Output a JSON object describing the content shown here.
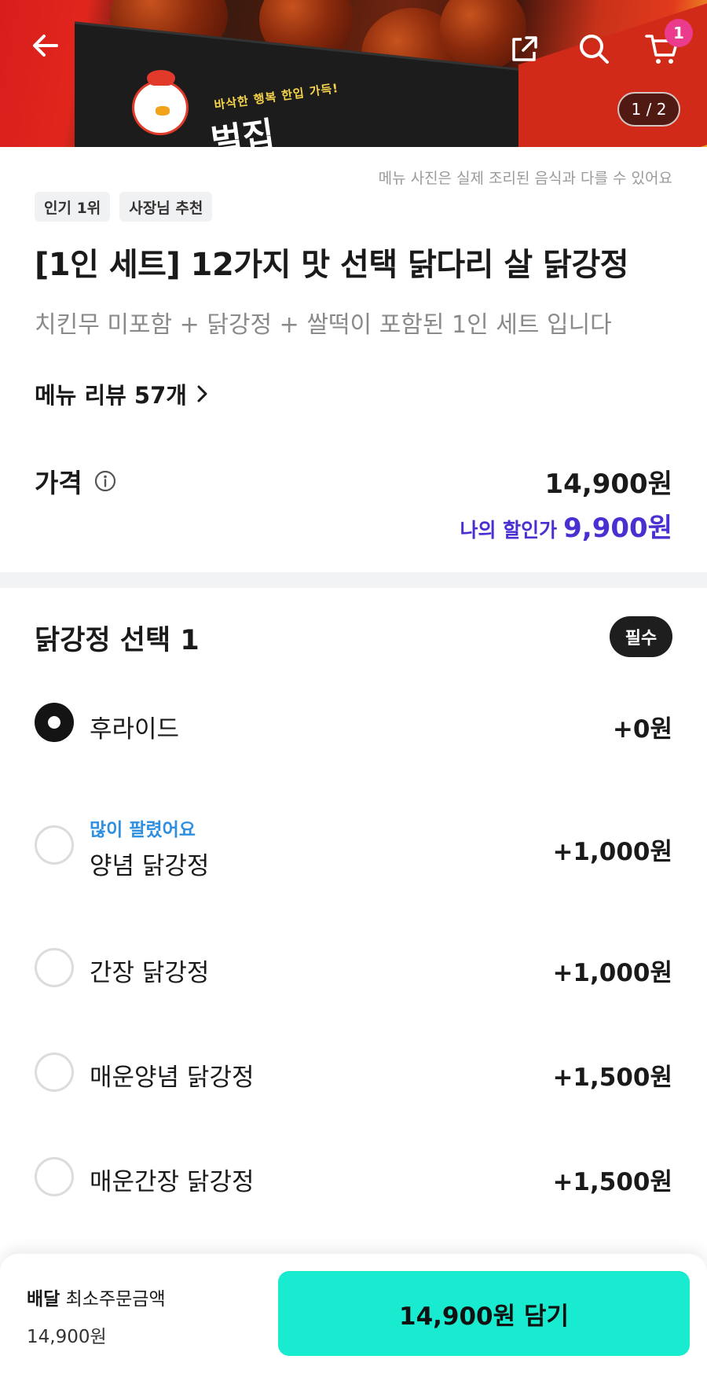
{
  "hero": {
    "box_slogan": "바삭한 행복 한입 가득!",
    "box_brand": "벌집",
    "page_indicator": "1 / 2",
    "cart_count": "1"
  },
  "photo_note": "메뉴 사진은 실제 조리된 음식과 다를 수 있어요",
  "tags": [
    "인기 1위",
    "사장님 추천"
  ],
  "title": "[1인 세트] 12가지 맛 선택 닭다리 살 닭강정",
  "description": "치킨무 미포함 + 닭강정 + 쌀떡이 포함된 1인 세트 입니다",
  "review_link": "메뉴 리뷰 57개",
  "price": {
    "label": "가격",
    "value": "14,900원",
    "discount_label": "나의 할인가",
    "discount_value": "9,900원"
  },
  "option_group": {
    "title": "닭강정 선택 1",
    "required_label": "필수",
    "options": [
      {
        "name": "후라이드",
        "price": "+0원",
        "checked": true,
        "badge": ""
      },
      {
        "name": "양념 닭강정",
        "price": "+1,000원",
        "checked": false,
        "badge": "많이 팔렸어요"
      },
      {
        "name": "간장 닭강정",
        "price": "+1,000원",
        "checked": false,
        "badge": ""
      },
      {
        "name": "매운양념 닭강정",
        "price": "+1,500원",
        "checked": false,
        "badge": ""
      },
      {
        "name": "매운간장 닭강정",
        "price": "+1,500원",
        "checked": false,
        "badge": ""
      }
    ]
  },
  "bottom_bar": {
    "delivery_label": "배달",
    "min_order_label": "최소주문금액",
    "min_order_value": "14,900원",
    "add_button_label": "14,900원 담기",
    "accent_color": "#18ebd0"
  },
  "colors": {
    "discount": "#4a2fd1",
    "badge": "#2f8fe0",
    "cart_badge": "#ea3b8c"
  }
}
